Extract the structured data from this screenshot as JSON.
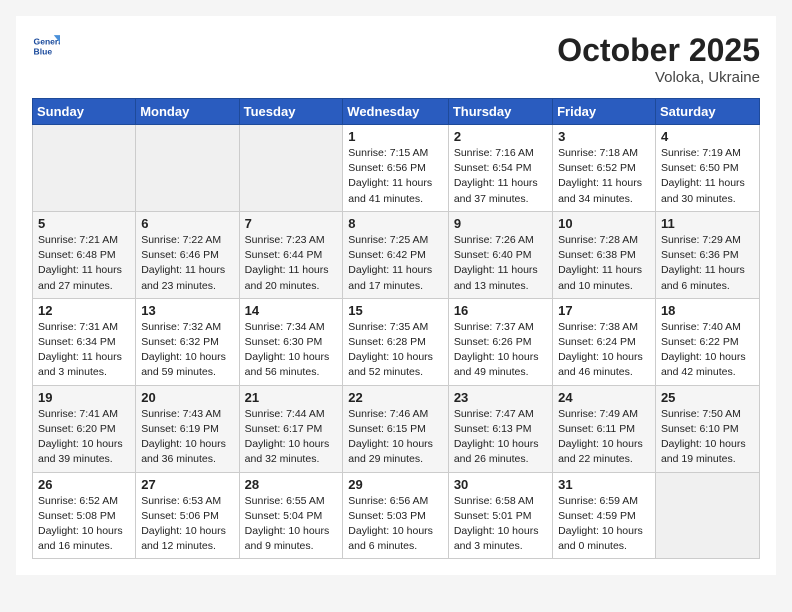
{
  "header": {
    "logo_line1": "General",
    "logo_line2": "Blue",
    "month": "October 2025",
    "location": "Voloka, Ukraine"
  },
  "weekdays": [
    "Sunday",
    "Monday",
    "Tuesday",
    "Wednesday",
    "Thursday",
    "Friday",
    "Saturday"
  ],
  "weeks": [
    [
      {
        "day": "",
        "empty": true
      },
      {
        "day": "",
        "empty": true
      },
      {
        "day": "",
        "empty": true
      },
      {
        "day": "1",
        "sunrise": "7:15 AM",
        "sunset": "6:56 PM",
        "daylight": "11 hours and 41 minutes."
      },
      {
        "day": "2",
        "sunrise": "7:16 AM",
        "sunset": "6:54 PM",
        "daylight": "11 hours and 37 minutes."
      },
      {
        "day": "3",
        "sunrise": "7:18 AM",
        "sunset": "6:52 PM",
        "daylight": "11 hours and 34 minutes."
      },
      {
        "day": "4",
        "sunrise": "7:19 AM",
        "sunset": "6:50 PM",
        "daylight": "11 hours and 30 minutes."
      }
    ],
    [
      {
        "day": "5",
        "sunrise": "7:21 AM",
        "sunset": "6:48 PM",
        "daylight": "11 hours and 27 minutes."
      },
      {
        "day": "6",
        "sunrise": "7:22 AM",
        "sunset": "6:46 PM",
        "daylight": "11 hours and 23 minutes."
      },
      {
        "day": "7",
        "sunrise": "7:23 AM",
        "sunset": "6:44 PM",
        "daylight": "11 hours and 20 minutes."
      },
      {
        "day": "8",
        "sunrise": "7:25 AM",
        "sunset": "6:42 PM",
        "daylight": "11 hours and 17 minutes."
      },
      {
        "day": "9",
        "sunrise": "7:26 AM",
        "sunset": "6:40 PM",
        "daylight": "11 hours and 13 minutes."
      },
      {
        "day": "10",
        "sunrise": "7:28 AM",
        "sunset": "6:38 PM",
        "daylight": "11 hours and 10 minutes."
      },
      {
        "day": "11",
        "sunrise": "7:29 AM",
        "sunset": "6:36 PM",
        "daylight": "11 hours and 6 minutes."
      }
    ],
    [
      {
        "day": "12",
        "sunrise": "7:31 AM",
        "sunset": "6:34 PM",
        "daylight": "11 hours and 3 minutes."
      },
      {
        "day": "13",
        "sunrise": "7:32 AM",
        "sunset": "6:32 PM",
        "daylight": "10 hours and 59 minutes."
      },
      {
        "day": "14",
        "sunrise": "7:34 AM",
        "sunset": "6:30 PM",
        "daylight": "10 hours and 56 minutes."
      },
      {
        "day": "15",
        "sunrise": "7:35 AM",
        "sunset": "6:28 PM",
        "daylight": "10 hours and 52 minutes."
      },
      {
        "day": "16",
        "sunrise": "7:37 AM",
        "sunset": "6:26 PM",
        "daylight": "10 hours and 49 minutes."
      },
      {
        "day": "17",
        "sunrise": "7:38 AM",
        "sunset": "6:24 PM",
        "daylight": "10 hours and 46 minutes."
      },
      {
        "day": "18",
        "sunrise": "7:40 AM",
        "sunset": "6:22 PM",
        "daylight": "10 hours and 42 minutes."
      }
    ],
    [
      {
        "day": "19",
        "sunrise": "7:41 AM",
        "sunset": "6:20 PM",
        "daylight": "10 hours and 39 minutes."
      },
      {
        "day": "20",
        "sunrise": "7:43 AM",
        "sunset": "6:19 PM",
        "daylight": "10 hours and 36 minutes."
      },
      {
        "day": "21",
        "sunrise": "7:44 AM",
        "sunset": "6:17 PM",
        "daylight": "10 hours and 32 minutes."
      },
      {
        "day": "22",
        "sunrise": "7:46 AM",
        "sunset": "6:15 PM",
        "daylight": "10 hours and 29 minutes."
      },
      {
        "day": "23",
        "sunrise": "7:47 AM",
        "sunset": "6:13 PM",
        "daylight": "10 hours and 26 minutes."
      },
      {
        "day": "24",
        "sunrise": "7:49 AM",
        "sunset": "6:11 PM",
        "daylight": "10 hours and 22 minutes."
      },
      {
        "day": "25",
        "sunrise": "7:50 AM",
        "sunset": "6:10 PM",
        "daylight": "10 hours and 19 minutes."
      }
    ],
    [
      {
        "day": "26",
        "sunrise": "6:52 AM",
        "sunset": "5:08 PM",
        "daylight": "10 hours and 16 minutes."
      },
      {
        "day": "27",
        "sunrise": "6:53 AM",
        "sunset": "5:06 PM",
        "daylight": "10 hours and 12 minutes."
      },
      {
        "day": "28",
        "sunrise": "6:55 AM",
        "sunset": "5:04 PM",
        "daylight": "10 hours and 9 minutes."
      },
      {
        "day": "29",
        "sunrise": "6:56 AM",
        "sunset": "5:03 PM",
        "daylight": "10 hours and 6 minutes."
      },
      {
        "day": "30",
        "sunrise": "6:58 AM",
        "sunset": "5:01 PM",
        "daylight": "10 hours and 3 minutes."
      },
      {
        "day": "31",
        "sunrise": "6:59 AM",
        "sunset": "4:59 PM",
        "daylight": "10 hours and 0 minutes."
      },
      {
        "day": "",
        "empty": true
      }
    ]
  ]
}
